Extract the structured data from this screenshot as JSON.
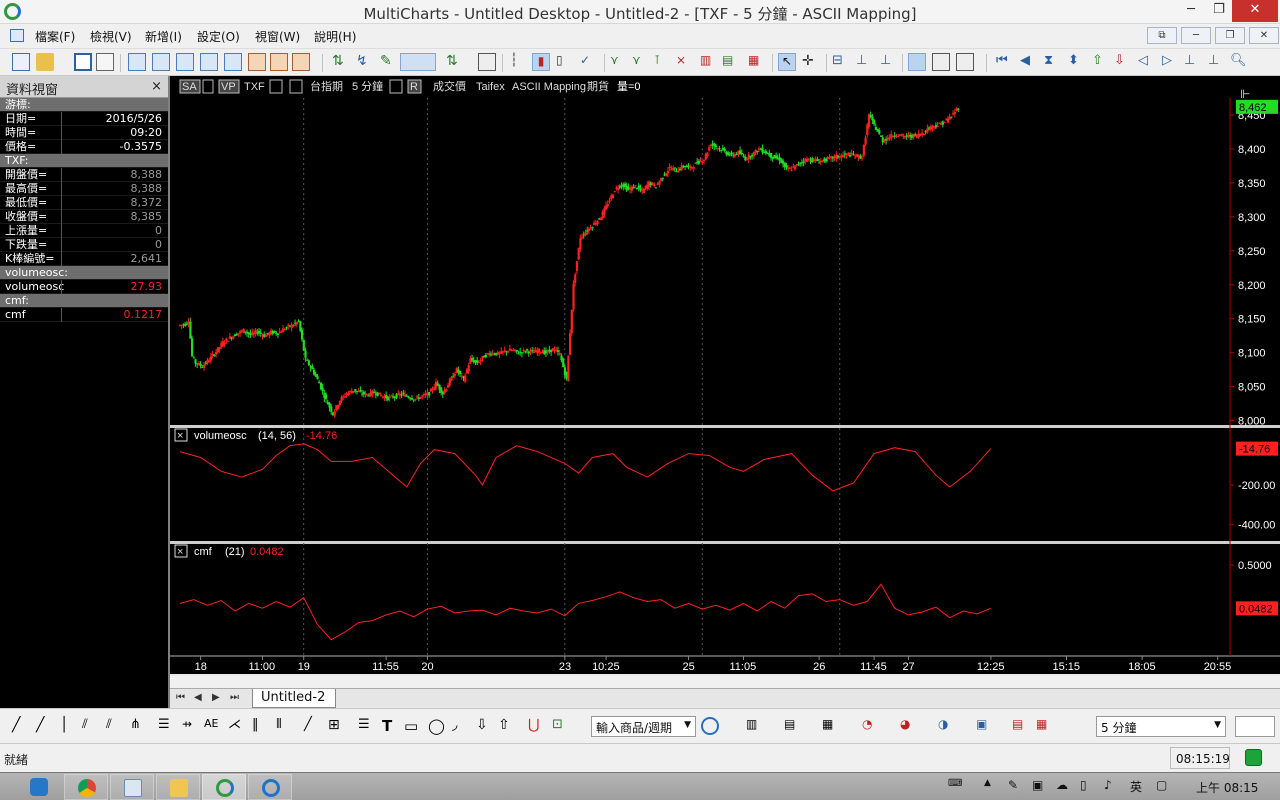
{
  "window": {
    "title": "MultiCharts - Untitled Desktop - Untitled-2 - [TXF - 5 分鐘 - ASCII Mapping]",
    "min": "─",
    "max": "❐",
    "close": "✕"
  },
  "menu": [
    "檔案(F)",
    "檢視(V)",
    "新增(I)",
    "設定(O)",
    "視窗(W)",
    "說明(H)"
  ],
  "data_window": {
    "title": "資料視窗",
    "close": "×",
    "rows": [
      {
        "k": "游標:",
        "v": "",
        "kind": "grey"
      },
      {
        "k": "日期=",
        "v": "2016/5/26",
        "kind": "val"
      },
      {
        "k": "時間=",
        "v": "09:20",
        "kind": "val"
      },
      {
        "k": "價格=",
        "v": "-0.3575",
        "kind": "val"
      },
      {
        "k": "TXF:",
        "v": "",
        "kind": "grey"
      },
      {
        "k": "開盤價=",
        "v": "8,388",
        "kind": "grey"
      },
      {
        "k": "最高價=",
        "v": "8,388",
        "kind": "grey"
      },
      {
        "k": "最低價=",
        "v": "8,372",
        "kind": "grey"
      },
      {
        "k": "收盤價=",
        "v": "8,385",
        "kind": "grey"
      },
      {
        "k": "上漲量=",
        "v": "0",
        "kind": "grey"
      },
      {
        "k": "下跌量=",
        "v": "0",
        "kind": "grey"
      },
      {
        "k": "K棒編號=",
        "v": "2,641",
        "kind": "grey"
      },
      {
        "k": "volumeosc:",
        "v": "",
        "kind": "grey"
      },
      {
        "k": "volumeosc",
        "v": "27.93",
        "kind": "red"
      },
      {
        "k": "cmf:",
        "v": "",
        "kind": "grey"
      },
      {
        "k": "cmf",
        "v": "0.1217",
        "kind": "red"
      }
    ]
  },
  "chart_header": {
    "sa": "SA",
    "vp": "VP",
    "symbol": "TXF",
    "desc": "台指期",
    "interval": "5 分鐘",
    "r": "R",
    "field": "成交價",
    "exchange": "Taifex",
    "datasource": "ASCII Mapping",
    "category": "期貨",
    "volume": "量=0"
  },
  "chart_data": [
    {
      "type": "candlestick",
      "symbol": "TXF",
      "y_ticks": [
        "8,000",
        "8,050",
        "8,100",
        "8,150",
        "8,200",
        "8,250",
        "8,300",
        "8,350",
        "8,400",
        "8,450"
      ],
      "ylim": [
        7995,
        8475
      ],
      "last_price": "8,462",
      "colors": {
        "up": "#ff2020",
        "down": "#22dd22"
      },
      "price_path": [
        [
          0,
          8140
        ],
        [
          2,
          8142
        ],
        [
          3,
          8148
        ],
        [
          4,
          8095
        ],
        [
          5,
          8085
        ],
        [
          7,
          8080
        ],
        [
          9,
          8090
        ],
        [
          11,
          8102
        ],
        [
          13,
          8115
        ],
        [
          15,
          8122
        ],
        [
          17,
          8128
        ],
        [
          19,
          8133
        ],
        [
          21,
          8126
        ],
        [
          23,
          8131
        ],
        [
          25,
          8125
        ],
        [
          27,
          8130
        ],
        [
          29,
          8129
        ],
        [
          31,
          8136
        ],
        [
          33,
          8140
        ],
        [
          35,
          8146
        ],
        [
          37,
          8090
        ],
        [
          39,
          8075
        ],
        [
          41,
          8055
        ],
        [
          43,
          8030
        ],
        [
          45,
          8010
        ],
        [
          47,
          8030
        ],
        [
          49,
          8040
        ],
        [
          51,
          8045
        ],
        [
          53,
          8041
        ],
        [
          55,
          8038
        ],
        [
          57,
          8042
        ],
        [
          59,
          8037
        ],
        [
          61,
          8033
        ],
        [
          63,
          8036
        ],
        [
          65,
          8039
        ],
        [
          67,
          8035
        ],
        [
          69,
          8032
        ],
        [
          71,
          8036
        ],
        [
          73,
          8040
        ],
        [
          75,
          8055
        ],
        [
          77,
          8040
        ],
        [
          79,
          8058
        ],
        [
          81,
          8075
        ],
        [
          83,
          8060
        ],
        [
          85,
          8090
        ],
        [
          87,
          8085
        ],
        [
          89,
          8095
        ],
        [
          91,
          8100
        ],
        [
          93,
          8098
        ],
        [
          95,
          8102
        ],
        [
          97,
          8104
        ],
        [
          99,
          8100
        ],
        [
          101,
          8103
        ],
        [
          103,
          8101
        ],
        [
          105,
          8103
        ],
        [
          107,
          8100
        ],
        [
          109,
          8105
        ],
        [
          111,
          8098
        ],
        [
          113,
          8060
        ],
        [
          115,
          8200
        ],
        [
          117,
          8270
        ],
        [
          119,
          8280
        ],
        [
          121,
          8290
        ],
        [
          123,
          8300
        ],
        [
          125,
          8320
        ],
        [
          127,
          8340
        ],
        [
          129,
          8348
        ],
        [
          131,
          8340
        ],
        [
          133,
          8345
        ],
        [
          135,
          8337
        ],
        [
          137,
          8350
        ],
        [
          139,
          8345
        ],
        [
          141,
          8360
        ],
        [
          143,
          8372
        ],
        [
          145,
          8368
        ],
        [
          147,
          8375
        ],
        [
          149,
          8372
        ],
        [
          151,
          8380
        ],
        [
          153,
          8385
        ],
        [
          155,
          8408
        ],
        [
          157,
          8402
        ],
        [
          159,
          8396
        ],
        [
          161,
          8390
        ],
        [
          163,
          8395
        ],
        [
          165,
          8386
        ],
        [
          167,
          8392
        ],
        [
          169,
          8400
        ],
        [
          171,
          8395
        ],
        [
          173,
          8388
        ],
        [
          175,
          8385
        ],
        [
          177,
          8370
        ],
        [
          179,
          8372
        ],
        [
          181,
          8380
        ],
        [
          183,
          8385
        ],
        [
          185,
          8383
        ],
        [
          187,
          8382
        ],
        [
          189,
          8385
        ],
        [
          191,
          8388
        ],
        [
          193,
          8390
        ],
        [
          195,
          8392
        ],
        [
          197,
          8390
        ],
        [
          199,
          8388
        ],
        [
          201,
          8450
        ],
        [
          203,
          8430
        ],
        [
          205,
          8412
        ],
        [
          207,
          8418
        ],
        [
          209,
          8422
        ],
        [
          211,
          8418
        ],
        [
          213,
          8419
        ],
        [
          215,
          8420
        ],
        [
          217,
          8425
        ],
        [
          219,
          8433
        ],
        [
          221,
          8435
        ],
        [
          223,
          8440
        ],
        [
          225,
          8448
        ],
        [
          227,
          8462
        ]
      ]
    },
    {
      "type": "line",
      "name": "volumeosc",
      "params": "(14, 56)",
      "last": "-14.76",
      "y_ticks": [
        "-200.00",
        "-400.00"
      ],
      "ylim": [
        -480,
        80
      ],
      "color": "#ff2020",
      "points": [
        [
          0,
          -30
        ],
        [
          6,
          -60
        ],
        [
          12,
          -130
        ],
        [
          18,
          -160
        ],
        [
          24,
          -120
        ],
        [
          28,
          -50
        ],
        [
          32,
          0
        ],
        [
          36,
          10
        ],
        [
          40,
          -20
        ],
        [
          44,
          -80
        ],
        [
          50,
          -80
        ],
        [
          56,
          -60
        ],
        [
          62,
          -150
        ],
        [
          66,
          -210
        ],
        [
          70,
          -90
        ],
        [
          74,
          -20
        ],
        [
          80,
          -40
        ],
        [
          86,
          -150
        ],
        [
          88,
          -200
        ],
        [
          92,
          -60
        ],
        [
          98,
          0
        ],
        [
          104,
          -30
        ],
        [
          112,
          -90
        ],
        [
          116,
          -140
        ],
        [
          120,
          -60
        ],
        [
          126,
          -40
        ],
        [
          130,
          -110
        ],
        [
          136,
          -160
        ],
        [
          142,
          -90
        ],
        [
          148,
          -40
        ],
        [
          154,
          -50
        ],
        [
          160,
          -110
        ],
        [
          164,
          -130
        ],
        [
          170,
          -70
        ],
        [
          178,
          -40
        ],
        [
          184,
          -150
        ],
        [
          190,
          -230
        ],
        [
          196,
          -190
        ],
        [
          202,
          -40
        ],
        [
          208,
          -10
        ],
        [
          214,
          -30
        ],
        [
          220,
          -150
        ],
        [
          224,
          -210
        ],
        [
          230,
          -130
        ],
        [
          236,
          -14.76
        ]
      ]
    },
    {
      "type": "line",
      "name": "cmf",
      "params": "(21)",
      "last": "0.0482",
      "y_ticks": [
        "0.5000"
      ],
      "ylim": [
        -0.45,
        0.7
      ],
      "color": "#ff2020",
      "points": [
        [
          0,
          0.1
        ],
        [
          4,
          0.14
        ],
        [
          8,
          0.08
        ],
        [
          12,
          0.13
        ],
        [
          16,
          0.02
        ],
        [
          20,
          0.1
        ],
        [
          24,
          0.05
        ],
        [
          28,
          0.12
        ],
        [
          32,
          0.06
        ],
        [
          36,
          0.16
        ],
        [
          40,
          -0.12
        ],
        [
          44,
          -0.28
        ],
        [
          48,
          -0.2
        ],
        [
          52,
          -0.1
        ],
        [
          56,
          -0.08
        ],
        [
          60,
          -0.02
        ],
        [
          64,
          0.02
        ],
        [
          68,
          -0.04
        ],
        [
          72,
          0.04
        ],
        [
          76,
          0.07
        ],
        [
          80,
          0.0
        ],
        [
          84,
          0.02
        ],
        [
          88,
          0.03
        ],
        [
          92,
          -0.02
        ],
        [
          96,
          0.05
        ],
        [
          100,
          0.02
        ],
        [
          104,
          0.0
        ],
        [
          108,
          0.04
        ],
        [
          112,
          -0.03
        ],
        [
          116,
          0.1
        ],
        [
          120,
          0.13
        ],
        [
          124,
          0.17
        ],
        [
          128,
          0.22
        ],
        [
          132,
          0.16
        ],
        [
          136,
          0.12
        ],
        [
          140,
          0.14
        ],
        [
          144,
          0.05
        ],
        [
          148,
          0.1
        ],
        [
          152,
          0.04
        ],
        [
          156,
          0.08
        ],
        [
          160,
          0.03
        ],
        [
          164,
          0.1
        ],
        [
          168,
          0.02
        ],
        [
          172,
          0.12
        ],
        [
          176,
          0.05
        ],
        [
          180,
          0.18
        ],
        [
          184,
          0.2
        ],
        [
          188,
          0.12
        ],
        [
          192,
          0.14
        ],
        [
          196,
          0.08
        ],
        [
          200,
          0.12
        ],
        [
          204,
          0.3
        ],
        [
          208,
          0.05
        ],
        [
          212,
          -0.02
        ],
        [
          216,
          0.01
        ],
        [
          220,
          0.06
        ],
        [
          224,
          -0.05
        ],
        [
          228,
          0.02
        ],
        [
          232,
          -0.01
        ],
        [
          236,
          0.0482
        ]
      ]
    }
  ],
  "x_axis": {
    "labels": [
      {
        "label": "18",
        "i": 6
      },
      {
        "label": "11:00",
        "i": 24
      },
      {
        "label": "19",
        "i": 36
      },
      {
        "label": "11:55",
        "i": 60
      },
      {
        "label": "20",
        "i": 72
      },
      {
        "label": "23",
        "i": 112
      },
      {
        "label": "10:25",
        "i": 124
      },
      {
        "label": "25",
        "i": 148
      },
      {
        "label": "11:05",
        "i": 164
      },
      {
        "label": "26",
        "i": 186
      },
      {
        "label": "11:45",
        "i": 202
      },
      {
        "label": "27",
        "i": 212
      },
      {
        "label": "12:25",
        "i": 236
      },
      {
        "label": "15:15",
        "i": 258
      },
      {
        "label": "18:05",
        "i": 280
      },
      {
        "label": "20:55",
        "i": 302
      }
    ],
    "day_breaks": [
      36,
      72,
      112,
      152,
      192
    ]
  },
  "tabs": {
    "sheet": "Untitled-2"
  },
  "drawbar": {
    "symbol_input": "輸入商品/週期",
    "interval": "5 分鐘"
  },
  "status": {
    "text": "就緒",
    "clock": "08:15:19"
  },
  "taskbar": {
    "ime": "英",
    "clock": "上午 08:15"
  }
}
